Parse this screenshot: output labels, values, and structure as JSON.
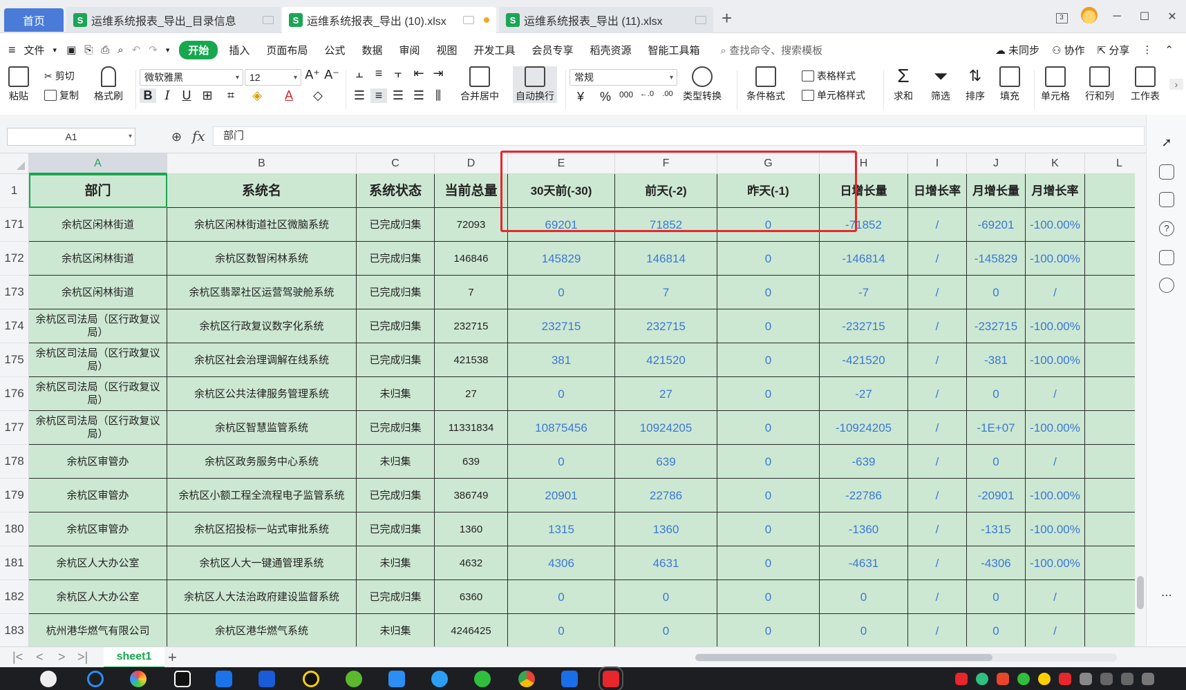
{
  "tabs": [
    {
      "label": "首页"
    },
    {
      "label": "运维系统报表_导出_目录信息"
    },
    {
      "label": "运维系统报表_导出 (10).xlsx"
    },
    {
      "label": "运维系统报表_导出 (11).xlsx"
    }
  ],
  "window": {
    "badge": "3"
  },
  "menu": {
    "file": "文件",
    "start": "开始",
    "insert": "插入",
    "layout": "页面布局",
    "formula": "公式",
    "data": "数据",
    "review": "审阅",
    "view": "视图",
    "dev": "开发工具",
    "member": "会员专享",
    "resource": "稻壳资源",
    "tools": "智能工具箱",
    "search": "查找命令、搜索模板",
    "sync": "未同步",
    "collab": "协作",
    "share": "分享"
  },
  "ribbon": {
    "paste": "粘贴",
    "cut": "剪切",
    "copy": "复制",
    "format_painter": "格式刷",
    "font": "微软雅黑",
    "size": "12",
    "merge": "合并居中",
    "wrap": "自动换行",
    "number_format": "常规",
    "convert": "类型转换",
    "cond_format": "条件格式",
    "table_style": "表格样式",
    "cell_style": "单元格样式",
    "sum": "求和",
    "filter": "筛选",
    "sort": "排序",
    "fill": "填充",
    "cell": "单元格",
    "rowcol": "行和列",
    "worksheet": "工作表",
    "bold": "B",
    "italic": "I",
    "underline": "U",
    "currency": "¥",
    "percent": "%",
    "thousands": "000"
  },
  "formula_bar": {
    "cell_ref": "A1",
    "fx": "fx",
    "content": "部门"
  },
  "columns": [
    "A",
    "B",
    "C",
    "D",
    "E",
    "F",
    "G",
    "H",
    "I",
    "J",
    "K",
    "L"
  ],
  "header_row": {
    "row_no": "1",
    "cells": [
      "部门",
      "系统名",
      "系统状态",
      "当前总量",
      "30天前(-30)",
      "前天(-2)",
      "昨天(-1)",
      "日增长量",
      "日增长率",
      "月增长量",
      "月增长率"
    ]
  },
  "rows": [
    {
      "no": "171",
      "cells": [
        "余杭区闲林街道",
        "余杭区闲林街道社区微脑系统",
        "已完成归集",
        "72093",
        "69201",
        "71852",
        "0",
        "-71852",
        "/",
        "-69201",
        "-100.00%"
      ]
    },
    {
      "no": "172",
      "cells": [
        "余杭区闲林街道",
        "余杭区数智闲林系统",
        "已完成归集",
        "146846",
        "145829",
        "146814",
        "0",
        "-146814",
        "/",
        "-145829",
        "-100.00%"
      ]
    },
    {
      "no": "173",
      "cells": [
        "余杭区闲林街道",
        "余杭区翡翠社区运营驾驶舱系统",
        "已完成归集",
        "7",
        "0",
        "7",
        "0",
        "-7",
        "/",
        "0",
        "/"
      ]
    },
    {
      "no": "174",
      "cells": [
        "余杭区司法局（区行政复议局）",
        "余杭区行政复议数字化系统",
        "已完成归集",
        "232715",
        "232715",
        "232715",
        "0",
        "-232715",
        "/",
        "-232715",
        "-100.00%"
      ]
    },
    {
      "no": "175",
      "cells": [
        "余杭区司法局（区行政复议局）",
        "余杭区社会治理调解在线系统",
        "已完成归集",
        "421538",
        "381",
        "421520",
        "0",
        "-421520",
        "/",
        "-381",
        "-100.00%"
      ]
    },
    {
      "no": "176",
      "cells": [
        "余杭区司法局（区行政复议局）",
        "余杭区公共法律服务管理系统",
        "未归集",
        "27",
        "0",
        "27",
        "0",
        "-27",
        "/",
        "0",
        "/"
      ]
    },
    {
      "no": "177",
      "cells": [
        "余杭区司法局（区行政复议局）",
        "余杭区智慧监管系统",
        "已完成归集",
        "11331834",
        "10875456",
        "10924205",
        "0",
        "-10924205",
        "/",
        "-1E+07",
        "-100.00%"
      ]
    },
    {
      "no": "178",
      "cells": [
        "余杭区审管办",
        "余杭区政务服务中心系统",
        "未归集",
        "639",
        "0",
        "639",
        "0",
        "-639",
        "/",
        "0",
        "/"
      ]
    },
    {
      "no": "179",
      "cells": [
        "余杭区审管办",
        "余杭区小额工程全流程电子监管系统",
        "已完成归集",
        "386749",
        "20901",
        "22786",
        "0",
        "-22786",
        "/",
        "-20901",
        "-100.00%"
      ]
    },
    {
      "no": "180",
      "cells": [
        "余杭区审管办",
        "余杭区招投标一站式审批系统",
        "已完成归集",
        "1360",
        "1315",
        "1360",
        "0",
        "-1360",
        "/",
        "-1315",
        "-100.00%"
      ]
    },
    {
      "no": "181",
      "cells": [
        "余杭区人大办公室",
        "余杭区人大一键通管理系统",
        "未归集",
        "4632",
        "4306",
        "4631",
        "0",
        "-4631",
        "/",
        "-4306",
        "-100.00%"
      ]
    },
    {
      "no": "182",
      "cells": [
        "余杭区人大办公室",
        "余杭区人大法治政府建设监督系统",
        "已完成归集",
        "6360",
        "0",
        "0",
        "0",
        "0",
        "/",
        "0",
        "/"
      ]
    },
    {
      "no": "183",
      "cells": [
        "杭州港华燃气有限公司",
        "余杭区港华燃气系统",
        "未归集",
        "4246425",
        "0",
        "0",
        "0",
        "0",
        "/",
        "0",
        "/"
      ]
    }
  ],
  "sheet": {
    "name": "sheet1"
  },
  "colors": {
    "accent": "#17a74f",
    "cell_fill": "#cde8d2",
    "number_text": "#3a78d4",
    "highlight": "#e8262b"
  }
}
